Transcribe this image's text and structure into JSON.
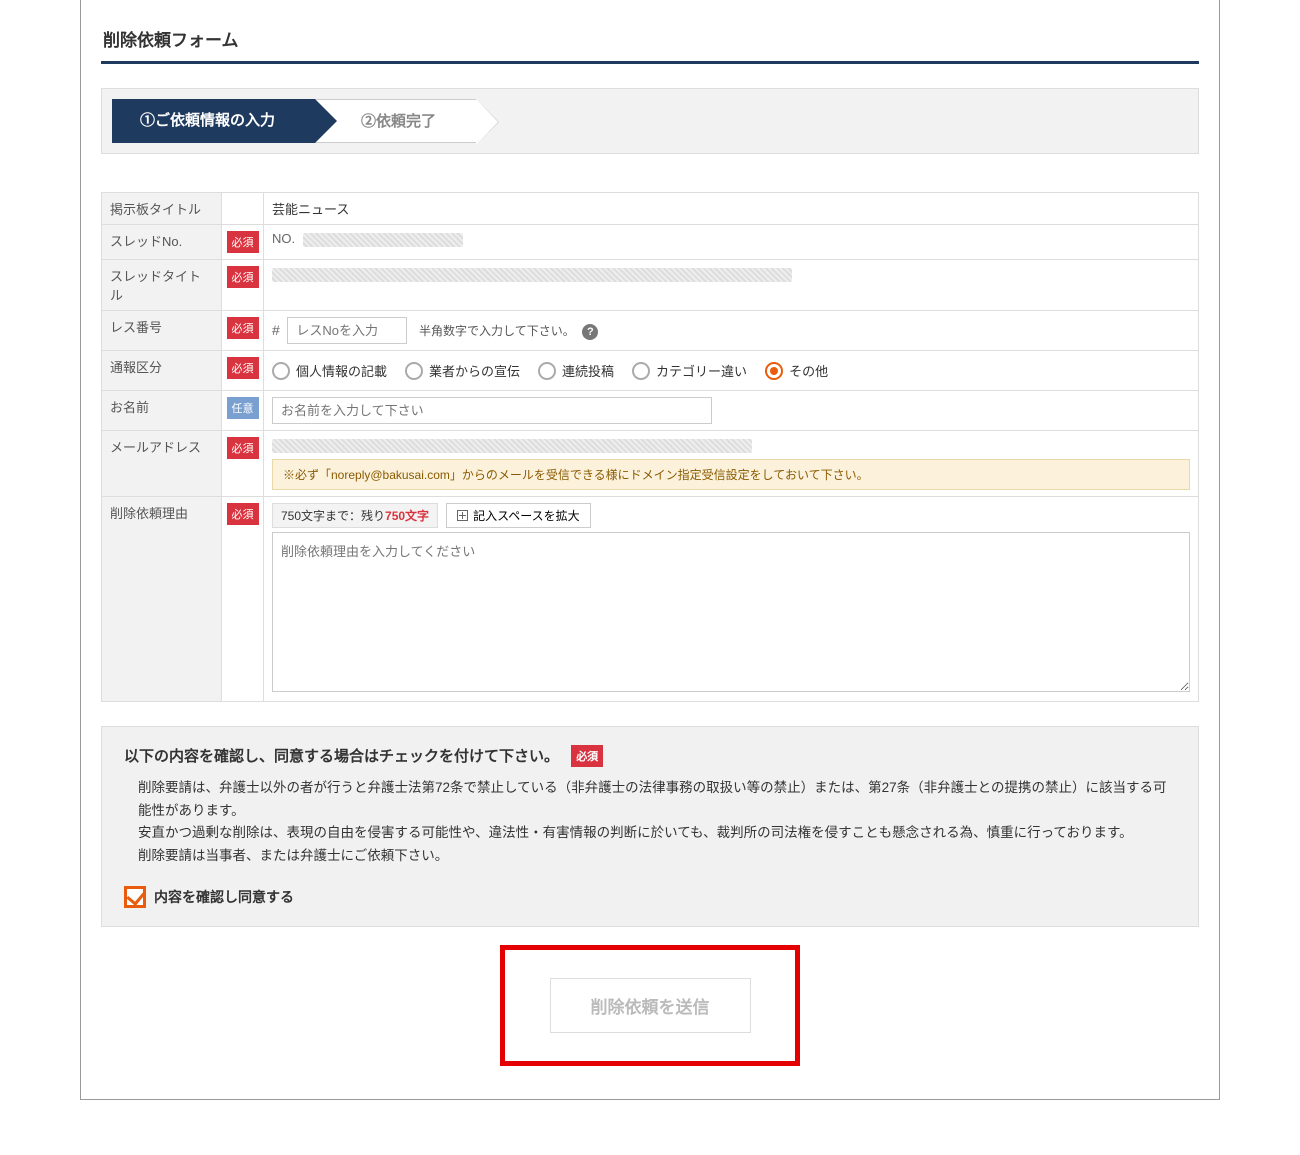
{
  "page": {
    "title": "削除依頼フォーム"
  },
  "progress": {
    "step1": "①ご依頼情報の入力",
    "step2": "②依頼完了"
  },
  "badges": {
    "required": "必須",
    "optional": "任意"
  },
  "fields": {
    "board_title": {
      "label": "掲示板タイトル",
      "value": "芸能ニュース"
    },
    "thread_no": {
      "label": "スレッドNo.",
      "prefix": "NO."
    },
    "thread_title": {
      "label": "スレッドタイトル"
    },
    "res_no": {
      "label": "レス番号",
      "hash": "#",
      "placeholder": "レスNoを入力",
      "hint": "半角数字で入力して下さい。"
    },
    "report_type": {
      "label": "通報区分",
      "options": [
        "個人情報の記載",
        "業者からの宣伝",
        "連続投稿",
        "カテゴリー違い",
        "その他"
      ],
      "selected": 4
    },
    "name": {
      "label": "お名前",
      "placeholder": "お名前を入力して下さい"
    },
    "email": {
      "label": "メールアドレス",
      "notice": "※必ず「noreply@bakusai.com」からのメールを受信できる様にドメイン指定受信設定をしておいて下さい。"
    },
    "reason": {
      "label": "削除依頼理由",
      "char_limit_prefix": "750文字まで：残り",
      "char_remaining": "750文字",
      "expand": "記入スペースを拡大",
      "placeholder": "削除依頼理由を入力してください"
    }
  },
  "consent": {
    "heading": "以下の内容を確認し、同意する場合はチェックを付けて下さい。",
    "body_line1": "削除要請は、弁護士以外の者が行うと弁護士法第72条で禁止している（非弁護士の法律事務の取扱い等の禁止）または、第27条（非弁護士との提携の禁止）に該当する可能性があります。",
    "body_line2": "安直かつ過剰な削除は、表現の自由を侵害する可能性や、違法性・有害情報の判断に於いても、裁判所の司法権を侵すことも懸念される為、慎重に行っております。",
    "body_line3": "削除要請は当事者、または弁護士にご依頼下さい。",
    "checkbox_label": "内容を確認し同意する"
  },
  "submit": {
    "label": "削除依頼を送信"
  }
}
